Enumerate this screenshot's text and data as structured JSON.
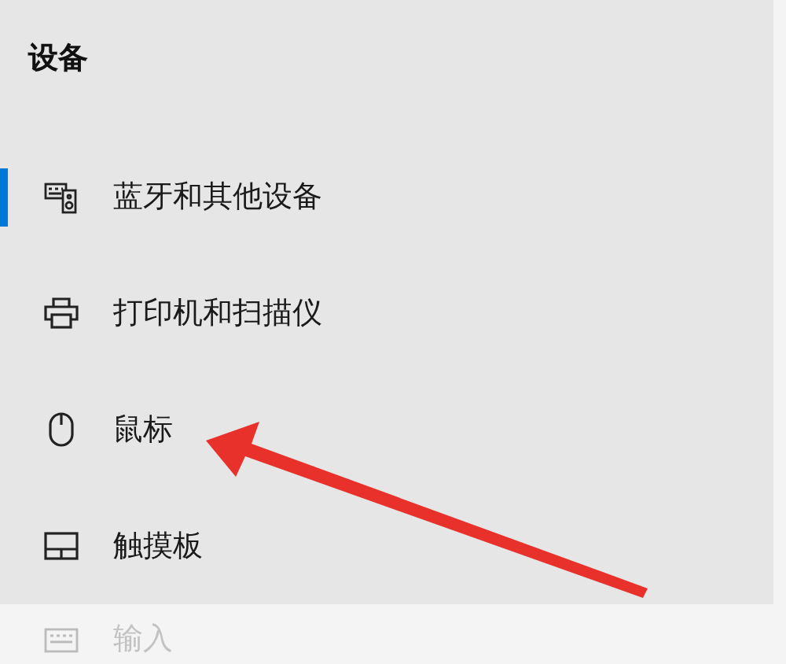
{
  "title": "设备",
  "items": [
    {
      "label": "蓝牙和其他设备",
      "selected": true,
      "dimmed": false
    },
    {
      "label": "打印机和扫描仪",
      "selected": false,
      "dimmed": false
    },
    {
      "label": "鼠标",
      "selected": false,
      "dimmed": false
    },
    {
      "label": "触摸板",
      "selected": false,
      "dimmed": false
    },
    {
      "label": "输入",
      "selected": false,
      "dimmed": true
    }
  ]
}
